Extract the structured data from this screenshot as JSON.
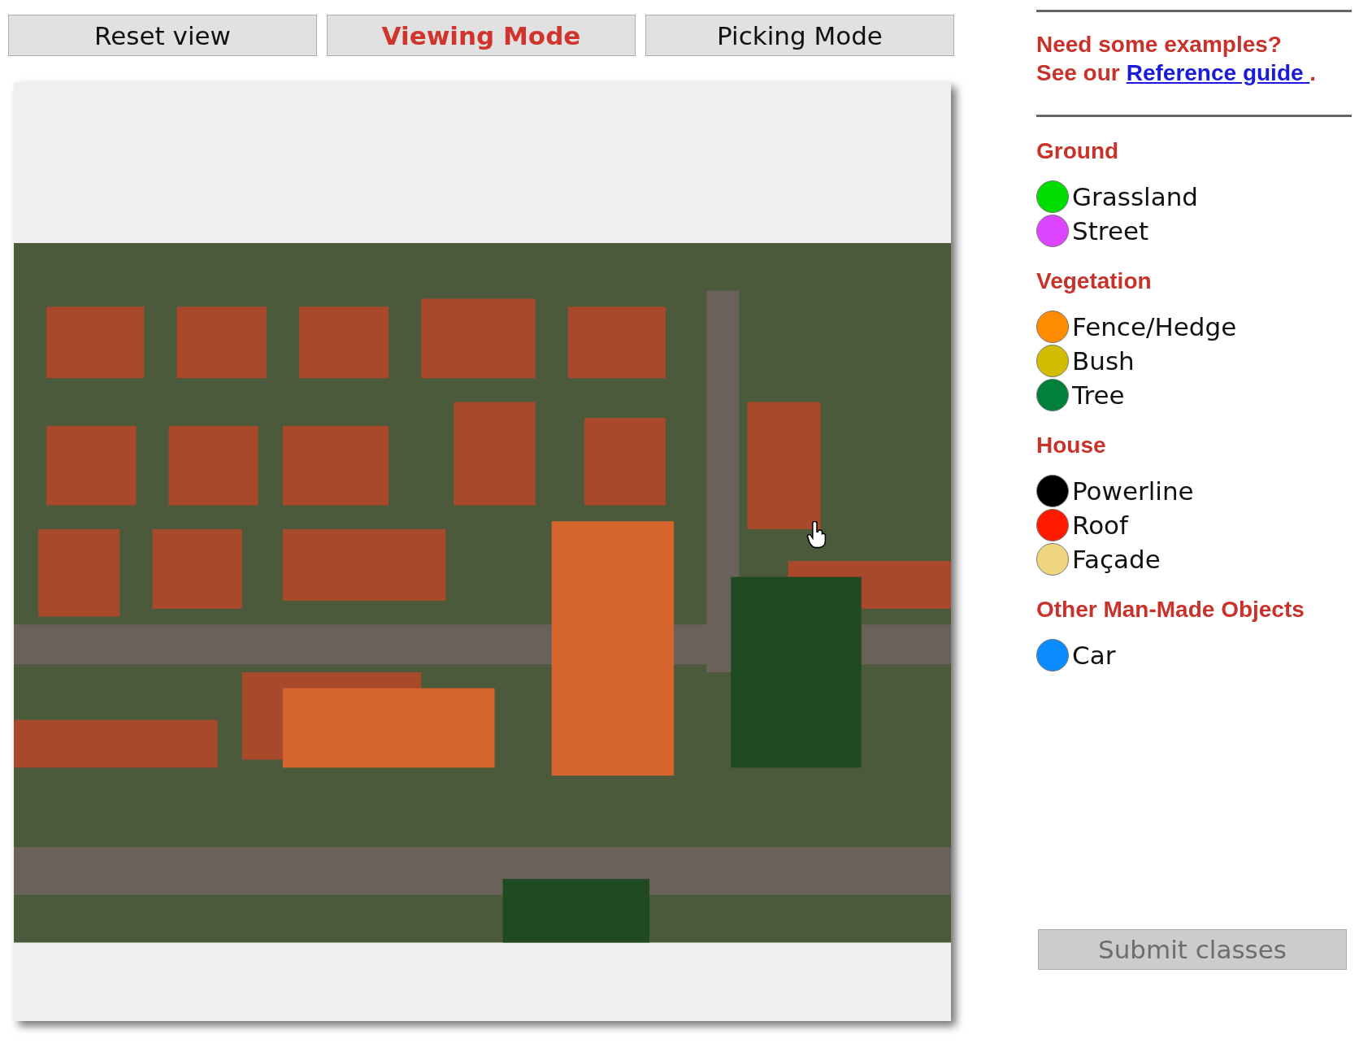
{
  "toolbar": {
    "buttons": [
      {
        "label": "Reset view",
        "selected": false
      },
      {
        "label": "Viewing Mode",
        "selected": true
      },
      {
        "label": "Picking Mode",
        "selected": false
      }
    ]
  },
  "help": {
    "line_1": "Need some examples?",
    "prefix": "See our",
    "link": "Reference guide ",
    "suffix": "."
  },
  "legend": [
    {
      "title": "Ground",
      "items": [
        {
          "label": "Grassland",
          "color": "#00dd00"
        },
        {
          "label": "Street",
          "color": "#dd44ff"
        }
      ]
    },
    {
      "title": "Vegetation",
      "items": [
        {
          "label": "Fence/Hedge",
          "color": "#ff8c00"
        },
        {
          "label": "Bush",
          "color": "#d4bd00"
        },
        {
          "label": "Tree",
          "color": "#00803a"
        }
      ]
    },
    {
      "title": "House",
      "items": [
        {
          "label": "Powerline",
          "color": "#000000"
        },
        {
          "label": "Roof",
          "color": "#ff1a00"
        },
        {
          "label": "Façade",
          "color": "#f0d580"
        }
      ]
    },
    {
      "title": "Other Man-Made Objects",
      "items": [
        {
          "label": "Car",
          "color": "#0a8cff"
        }
      ]
    }
  ],
  "submit": {
    "label": "Submit classes",
    "disabled": true
  }
}
